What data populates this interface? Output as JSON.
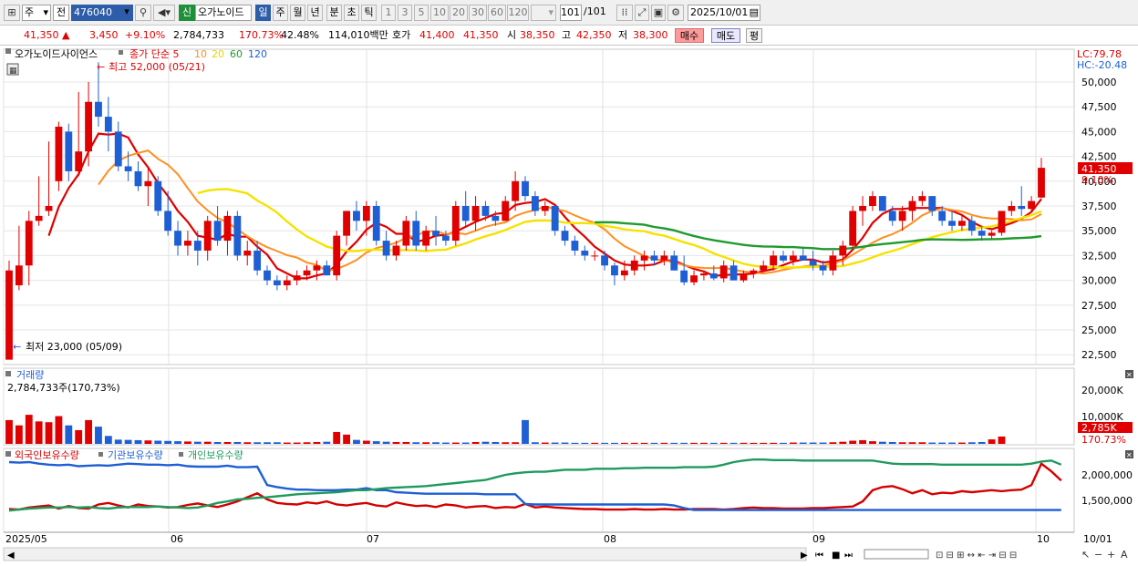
{
  "toolbar": {
    "market_label": "주",
    "type_label": "전",
    "code_value": "476040",
    "stock_badge": "신",
    "stock_name": "오가노이드",
    "periods": [
      "일",
      "주",
      "월",
      "년",
      "분",
      "초",
      "틱"
    ],
    "active_period": "일",
    "intervals": [
      "1",
      "3",
      "5",
      "10",
      "20",
      "30",
      "60",
      "120"
    ],
    "count_value": "101",
    "count_total": "/101",
    "date_value": "2025/10/01"
  },
  "pricebar": {
    "price": "41,350",
    "change": "3,450",
    "change_pct": "+9.10%",
    "volume": "2,784,733",
    "volume_pct": "170.73%",
    "turnover_pct": "42.48%",
    "amount": "114,010백만",
    "ask_label": "호가",
    "ask": "41,400",
    "bid": "41,350",
    "open_label": "시",
    "open": "38,350",
    "high_label": "고",
    "high": "42,350",
    "low_label": "저",
    "low": "38,300",
    "buy_label": "매수",
    "sell_label": "매도",
    "avg_label": "평"
  },
  "price_panel": {
    "legend_name": "오가노이드사이언스",
    "legend_ma": "종가 단순 5",
    "ma_labels": [
      "10",
      "20",
      "60",
      "120"
    ],
    "colors": {
      "up": "#e00000",
      "down": "#1e5fd4",
      "ma5": "#e00000",
      "ma10": "#ff9020",
      "ma20": "#f5e200",
      "ma60": "#1f9a2e",
      "ma120": "#1e5fd4"
    },
    "high_note": "최고 52,000 (05/21)",
    "low_note": "최저 23,000 (05/09)",
    "lc": "LC:79.78",
    "hc": "HC:-20.48",
    "last_price": "41,350",
    "last_pct": "9.10%",
    "y_ticks": [
      "50,000",
      "47,500",
      "45,000",
      "42,500",
      "40,000",
      "37,500",
      "35,000",
      "32,500",
      "30,000",
      "27,500",
      "25,000",
      "22,500"
    ]
  },
  "volume_panel": {
    "title": "거래량",
    "value": "2,784,733주(170,73%)",
    "y_ticks": [
      "20,000K",
      "10,000K"
    ],
    "last": "2,785K",
    "last_pct": "170.73%"
  },
  "holding_panel": {
    "legend": [
      "외국인보유수량",
      "기관보유수량",
      "개인보유수량"
    ],
    "colors": [
      "#d40000",
      "#1e5fd4",
      "#1f9a5e"
    ],
    "y_ticks": [
      "2,000,000",
      "1,500,000"
    ]
  },
  "x_axis": {
    "labels": [
      "2025/05",
      "06",
      "07",
      "08",
      "09",
      "10"
    ],
    "right_label": "10/01"
  },
  "chart_data": {
    "type": "candlestick",
    "candles": [
      [
        22000,
        32000,
        23000,
        31000
      ],
      [
        29500,
        35500,
        29000,
        31500
      ],
      [
        31500,
        37000,
        29500,
        36000
      ],
      [
        36000,
        40500,
        35500,
        36500
      ],
      [
        37000,
        44000,
        36500,
        37500
      ],
      [
        40000,
        46000,
        39000,
        45500
      ],
      [
        45000,
        45800,
        40000,
        41000
      ],
      [
        41000,
        49000,
        40500,
        43000
      ],
      [
        43000,
        50000,
        41500,
        48000
      ],
      [
        48000,
        52000,
        45500,
        46500
      ],
      [
        46500,
        48500,
        43000,
        45000
      ],
      [
        45000,
        46000,
        41000,
        41500
      ],
      [
        41500,
        43000,
        40000,
        41000
      ],
      [
        41000,
        42000,
        39000,
        39500
      ],
      [
        39500,
        41500,
        37500,
        40000
      ],
      [
        40000,
        40500,
        36500,
        37000
      ],
      [
        37000,
        39000,
        34500,
        35000
      ],
      [
        35000,
        36000,
        32500,
        33500
      ],
      [
        33500,
        35000,
        32500,
        34000
      ],
      [
        34000,
        35000,
        31500,
        33000
      ],
      [
        33000,
        36500,
        32000,
        36000
      ],
      [
        36000,
        37500,
        33500,
        34000
      ],
      [
        34000,
        37000,
        32500,
        36500
      ],
      [
        36500,
        37000,
        32000,
        32500
      ],
      [
        32500,
        34000,
        31500,
        33000
      ],
      [
        33000,
        34000,
        30500,
        31000
      ],
      [
        31000,
        31500,
        29500,
        30000
      ],
      [
        30000,
        30500,
        29000,
        29500
      ],
      [
        29500,
        30500,
        29000,
        30000
      ],
      [
        30000,
        31000,
        29500,
        30500
      ],
      [
        30500,
        31500,
        30000,
        31000
      ],
      [
        31000,
        32000,
        30000,
        31500
      ],
      [
        31500,
        32000,
        30500,
        30500
      ],
      [
        30500,
        35000,
        30000,
        34500
      ],
      [
        34500,
        37000,
        33500,
        37000
      ],
      [
        37000,
        38000,
        35000,
        36000
      ],
      [
        36000,
        38000,
        34500,
        37500
      ],
      [
        37500,
        38000,
        33500,
        34000
      ],
      [
        34000,
        35000,
        32000,
        32500
      ],
      [
        32500,
        34000,
        32000,
        33500
      ],
      [
        33500,
        36500,
        33000,
        36000
      ],
      [
        36000,
        37000,
        33000,
        33500
      ],
      [
        33500,
        35500,
        33000,
        35000
      ],
      [
        35000,
        36500,
        33500,
        34500
      ],
      [
        34500,
        35000,
        33500,
        34000
      ],
      [
        34000,
        38000,
        33500,
        37500
      ],
      [
        37500,
        39000,
        35500,
        36000
      ],
      [
        36000,
        38500,
        35000,
        37500
      ],
      [
        37500,
        38000,
        36000,
        36500
      ],
      [
        36500,
        37000,
        35500,
        36000
      ],
      [
        36000,
        38500,
        36000,
        38000
      ],
      [
        38000,
        41000,
        37000,
        40000
      ],
      [
        40000,
        40500,
        38000,
        38500
      ],
      [
        38500,
        39000,
        36500,
        37000
      ],
      [
        37000,
        38000,
        36500,
        37500
      ],
      [
        37500,
        37500,
        34500,
        35000
      ],
      [
        35000,
        35500,
        33500,
        34000
      ],
      [
        34000,
        34500,
        32500,
        33000
      ],
      [
        33000,
        33500,
        32000,
        32500
      ],
      [
        32500,
        33000,
        32000,
        32500
      ],
      [
        32500,
        33000,
        31000,
        31500
      ],
      [
        31500,
        31800,
        29500,
        30500
      ],
      [
        30500,
        32000,
        30000,
        31000
      ],
      [
        31000,
        32500,
        30500,
        32000
      ],
      [
        32000,
        33000,
        31000,
        32500
      ],
      [
        32500,
        33000,
        31500,
        32000
      ],
      [
        32000,
        33000,
        31500,
        32500
      ],
      [
        32500,
        33000,
        31000,
        31000
      ],
      [
        31000,
        32500,
        29500,
        29800
      ],
      [
        29800,
        31000,
        29500,
        30500
      ],
      [
        30500,
        31000,
        30000,
        30700
      ],
      [
        30700,
        31500,
        30000,
        30200
      ],
      [
        30200,
        32000,
        29800,
        31500
      ],
      [
        31500,
        32000,
        30000,
        30000
      ],
      [
        30000,
        31000,
        29800,
        30700
      ],
      [
        30700,
        31200,
        30200,
        31000
      ],
      [
        31000,
        32000,
        30800,
        31500
      ],
      [
        31500,
        33000,
        31000,
        32500
      ],
      [
        32500,
        33000,
        31800,
        32000
      ],
      [
        32000,
        33000,
        31500,
        32500
      ],
      [
        32500,
        33200,
        32000,
        32000
      ],
      [
        32000,
        33000,
        31000,
        31500
      ],
      [
        31500,
        32000,
        30500,
        31000
      ],
      [
        31000,
        33000,
        30500,
        32500
      ],
      [
        32500,
        34000,
        31500,
        33500
      ],
      [
        33500,
        37500,
        33000,
        37000
      ],
      [
        37000,
        38500,
        35500,
        37500
      ],
      [
        37500,
        39000,
        37000,
        38500
      ],
      [
        38500,
        38500,
        37000,
        37000
      ],
      [
        37000,
        37500,
        35500,
        36000
      ],
      [
        36000,
        37500,
        35000,
        37000
      ],
      [
        37000,
        38500,
        36000,
        38000
      ],
      [
        38000,
        39000,
        37500,
        38500
      ],
      [
        38500,
        38500,
        36500,
        37000
      ],
      [
        37000,
        37500,
        35500,
        36000
      ],
      [
        36000,
        37000,
        35000,
        35500
      ],
      [
        35500,
        36500,
        35000,
        36000
      ],
      [
        36000,
        36500,
        34500,
        35000
      ],
      [
        35000,
        35500,
        34000,
        34500
      ],
      [
        34500,
        35000,
        34200,
        34800
      ],
      [
        34800,
        37000,
        34500,
        37000
      ],
      [
        37000,
        38000,
        36500,
        37500
      ],
      [
        37500,
        39500,
        36500,
        37200
      ],
      [
        37200,
        38500,
        37000,
        38000
      ],
      [
        38350,
        42350,
        38300,
        41350
      ]
    ],
    "volume_k": [
      9000,
      7000,
      11000,
      8500,
      8200,
      10500,
      7000,
      5200,
      9000,
      6500,
      3000,
      1600,
      1500,
      1400,
      1300,
      1200,
      1100,
      1000,
      900,
      800,
      800,
      700,
      700,
      700,
      600,
      600,
      600,
      600,
      500,
      500,
      600,
      700,
      800,
      4500,
      3500,
      1500,
      1200,
      1000,
      800,
      700,
      700,
      600,
      600,
      600,
      500,
      500,
      500,
      700,
      800,
      700,
      600,
      600,
      9000,
      600,
      500,
      500,
      500,
      400,
      400,
      400,
      400,
      400,
      400,
      400,
      400,
      400,
      400,
      400,
      400,
      400,
      400,
      400,
      400,
      400,
      400,
      400,
      400,
      400,
      400,
      500,
      500,
      500,
      500,
      600,
      800,
      1200,
      1400,
      1000,
      800,
      700,
      600,
      600,
      600,
      500,
      500,
      500,
      500,
      600,
      700,
      1700,
      2785
    ],
    "foreign": [
      1.33,
      1.32,
      1.36,
      1.38,
      1.4,
      1.34,
      1.39,
      1.35,
      1.34,
      1.42,
      1.45,
      1.4,
      1.36,
      1.42,
      1.39,
      1.38,
      1.36,
      1.37,
      1.41,
      1.44,
      1.4,
      1.37,
      1.42,
      1.48,
      1.56,
      1.64,
      1.52,
      1.45,
      1.43,
      1.42,
      1.46,
      1.44,
      1.48,
      1.42,
      1.4,
      1.43,
      1.45,
      1.4,
      1.38,
      1.46,
      1.42,
      1.39,
      1.4,
      1.37,
      1.42,
      1.4,
      1.36,
      1.38,
      1.39,
      1.35,
      1.37,
      1.36,
      1.43,
      1.36,
      1.38,
      1.36,
      1.35,
      1.34,
      1.33,
      1.33,
      1.32,
      1.32,
      1.32,
      1.33,
      1.32,
      1.32,
      1.33,
      1.32,
      1.32,
      1.33,
      1.33,
      1.33,
      1.32,
      1.33,
      1.35,
      1.36,
      1.35,
      1.35,
      1.34,
      1.34,
      1.34,
      1.35,
      1.35,
      1.36,
      1.37,
      1.38,
      1.48,
      1.7,
      1.76,
      1.78,
      1.72,
      1.64,
      1.7,
      1.62,
      1.65,
      1.64,
      1.68,
      1.66,
      1.68,
      1.7,
      1.68,
      1.7,
      1.71,
      1.8,
      2.22,
      2.07,
      1.89
    ],
    "institution": [
      2.25,
      2.24,
      2.25,
      2.22,
      2.2,
      2.19,
      2.2,
      2.17,
      2.18,
      2.19,
      2.18,
      2.2,
      2.22,
      2.21,
      2.2,
      2.2,
      2.19,
      2.2,
      2.17,
      2.16,
      2.16,
      2.16,
      2.18,
      2.15,
      2.15,
      2.16,
      1.8,
      1.76,
      1.73,
      1.71,
      1.71,
      1.7,
      1.7,
      1.7,
      1.71,
      1.71,
      1.74,
      1.7,
      1.7,
      1.66,
      1.65,
      1.64,
      1.63,
      1.63,
      1.63,
      1.63,
      1.63,
      1.63,
      1.62,
      1.62,
      1.62,
      1.62,
      1.43,
      1.42,
      1.42,
      1.42,
      1.42,
      1.42,
      1.42,
      1.42,
      1.42,
      1.42,
      1.42,
      1.42,
      1.42,
      1.42,
      1.42,
      1.4,
      1.35,
      1.31,
      1.31,
      1.31,
      1.31,
      1.31,
      1.31,
      1.31,
      1.31,
      1.31,
      1.31,
      1.31,
      1.31,
      1.31,
      1.31,
      1.31,
      1.31,
      1.31,
      1.31,
      1.31,
      1.31,
      1.31,
      1.31,
      1.31,
      1.31,
      1.31,
      1.31,
      1.31,
      1.31,
      1.31,
      1.31,
      1.31,
      1.31,
      1.31,
      1.31,
      1.31,
      1.31,
      1.31,
      1.31
    ],
    "individual": [
      1.3,
      1.32,
      1.34,
      1.35,
      1.36,
      1.36,
      1.37,
      1.36,
      1.37,
      1.35,
      1.34,
      1.36,
      1.37,
      1.37,
      1.37,
      1.38,
      1.37,
      1.36,
      1.35,
      1.36,
      1.4,
      1.45,
      1.48,
      1.52,
      1.53,
      1.55,
      1.56,
      1.58,
      1.6,
      1.62,
      1.63,
      1.64,
      1.65,
      1.66,
      1.68,
      1.7,
      1.7,
      1.72,
      1.74,
      1.75,
      1.76,
      1.77,
      1.78,
      1.8,
      1.82,
      1.84,
      1.86,
      1.88,
      1.9,
      1.95,
      2.0,
      2.03,
      2.05,
      2.06,
      2.06,
      2.08,
      2.1,
      2.1,
      2.1,
      2.12,
      2.12,
      2.12,
      2.13,
      2.13,
      2.14,
      2.14,
      2.14,
      2.14,
      2.15,
      2.15,
      2.15,
      2.16,
      2.2,
      2.25,
      2.28,
      2.3,
      2.3,
      2.29,
      2.29,
      2.29,
      2.28,
      2.28,
      2.28,
      2.28,
      2.28,
      2.28,
      2.28,
      2.28,
      2.25,
      2.22,
      2.21,
      2.21,
      2.21,
      2.21,
      2.2,
      2.2,
      2.2,
      2.2,
      2.2,
      2.2,
      2.2,
      2.2,
      2.2,
      2.22,
      2.26,
      2.28,
      2.2
    ]
  }
}
